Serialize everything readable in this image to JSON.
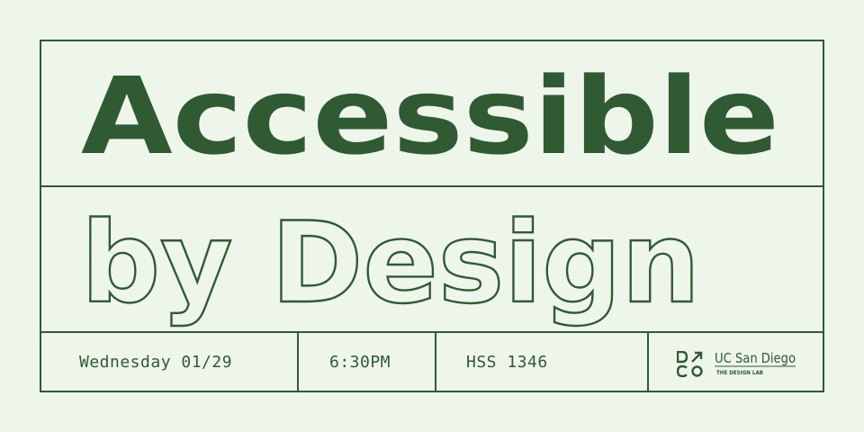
{
  "colors": {
    "background": "#eef6ec",
    "accent": "#2f5a32"
  },
  "title": "Accessible",
  "subtitle": "by Design",
  "event": {
    "date": "Wednesday 01/29",
    "time": "6:30PM",
    "location": "HSS 1346"
  },
  "logos": {
    "dco_mark": "DCO",
    "ucsd_name": "UC San Diego",
    "lab_name": "THE DESIGN LAB"
  }
}
